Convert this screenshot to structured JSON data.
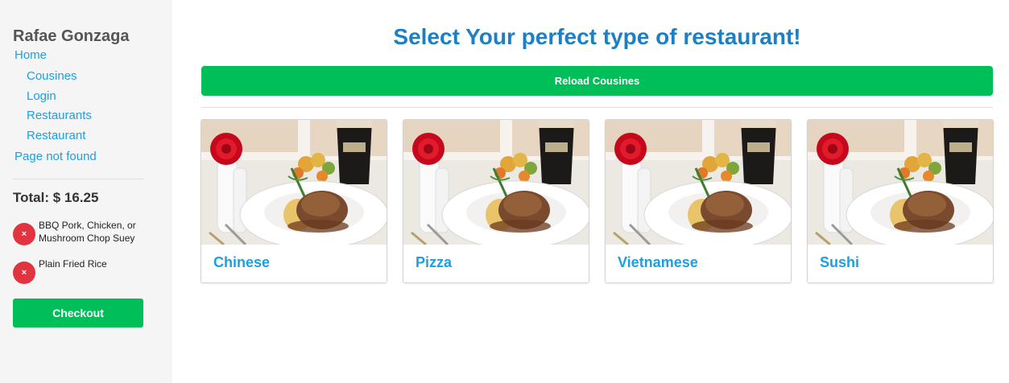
{
  "sidebar": {
    "brand": "Rafae Gonzaga",
    "nav": {
      "home": "Home",
      "cousines": "Cousines",
      "login": "Login",
      "restaurants": "Restaurants",
      "restaurant": "Restaurant",
      "not_found": "Page not found"
    },
    "total_label": "Total: $ 16.25",
    "cart_items": [
      {
        "label": "BBQ Pork, Chicken, or Mushroom Chop Suey",
        "remove_glyph": "×"
      },
      {
        "label": "Plain Fried Rice",
        "remove_glyph": "×"
      }
    ],
    "checkout_label": "Checkout"
  },
  "main": {
    "title": "Select Your perfect type of restaurant!",
    "reload_label": "Reload Cousines",
    "cards": [
      {
        "title": "Chinese"
      },
      {
        "title": "Pizza"
      },
      {
        "title": "Vietnamese"
      },
      {
        "title": "Sushi"
      }
    ]
  },
  "colors": {
    "accent_blue": "#1ba1e2",
    "title_blue": "#1d7fc4",
    "button_green": "#00bf58",
    "remove_red": "#e2343f",
    "sidebar_bg": "#f5f5f5"
  },
  "icons": {
    "remove": "close-icon",
    "card_image": "food-photo-image"
  }
}
